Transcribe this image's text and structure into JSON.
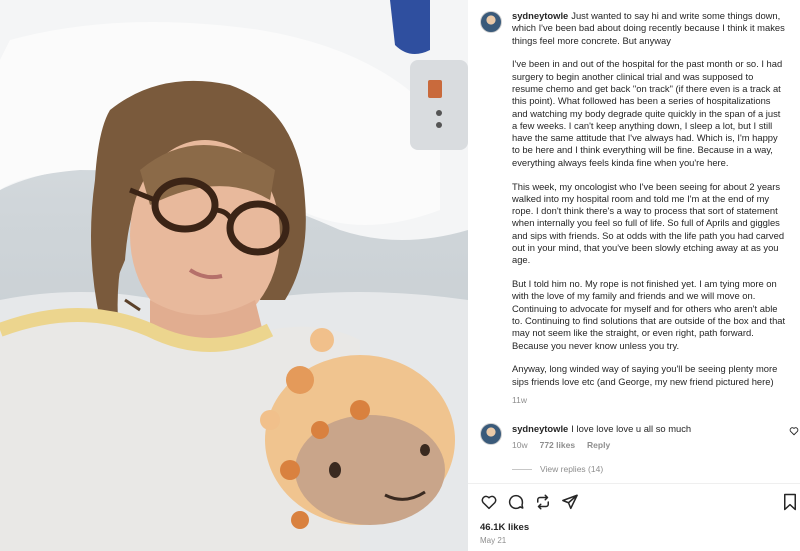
{
  "photo": {
    "description_icon": "photo"
  },
  "post": {
    "username": "sydneytowle",
    "paragraphs": [
      "Just wanted to say hi and write some things down, which I've been bad about doing recently because I think it makes things feel more concrete. But anyway",
      "I've been in and out of the hospital for the past month or so. I had surgery to begin another clinical trial and was supposed to resume chemo and get back \"on track\" (if there even is a track at this point). What followed has been a series of hospitalizations and watching my body degrade quite quickly in the span of a just a few weeks. I can't keep anything down, I sleep a lot, but I still have the same attitude that I've always had. Which is, I'm happy to be here and I think everything will be fine. Because in a way, everything always feels kinda fine when you're here.",
      "This week, my oncologist who I've been seeing for about 2 years walked into my hospital room and told me I'm at the end of my rope. I don't think there's a way to process that sort of statement when internally you feel so full of life. So full of Aprils and giggles and sips with friends. So at odds with the life path you had carved out in your mind, that you've been slowly etching away at as you age.",
      "But I told him no. My rope is not finished yet. I am tying more on with the love of my family and friends and we will move on. Continuing to advocate for myself and for others who aren't able to. Continuing to find solutions that are outside of the box and that may not seem like the straight, or even right, path forward. Because you never know unless you try.",
      "Anyway, long winded way of saying you'll be seeing plenty more sips friends love etc (and George, my new friend pictured here)"
    ],
    "time": "11w"
  },
  "comment": {
    "username": "sydneytowle",
    "text": "I love love love u all so much",
    "time": "10w",
    "likes": "772 likes",
    "reply": "Reply",
    "view_replies": "View replies (14)"
  },
  "actions": {
    "icons": [
      "heart-icon",
      "comment-icon",
      "share-icon",
      "send-icon",
      "bookmark-icon"
    ]
  },
  "footer": {
    "likes": "46.1K likes",
    "date": "May 21"
  }
}
